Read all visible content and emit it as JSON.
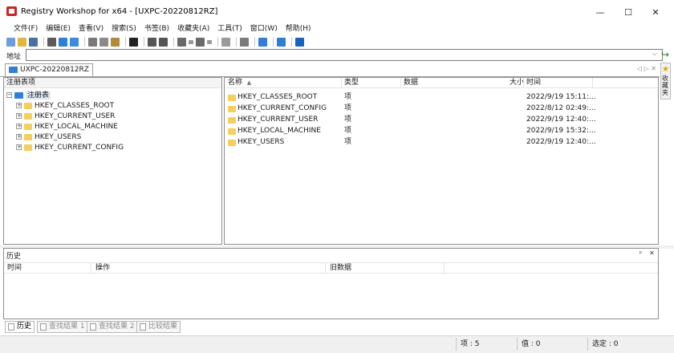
{
  "window": {
    "title": "Registry Workshop for x64 - [UXPC-20220812RZ]",
    "controls": {
      "minimize": "—",
      "maximize": "☐",
      "close": "✕"
    }
  },
  "menu": [
    "文件(F)",
    "编辑(E)",
    "查看(V)",
    "搜索(S)",
    "书签(B)",
    "收藏夹(A)",
    "工具(T)",
    "窗口(W)",
    "帮助(H)"
  ],
  "toolbar": {
    "icons": [
      "new-icon",
      "open-icon",
      "save-icon",
      "separator",
      "connect-icon",
      "computer-icon",
      "network-icon",
      "separator",
      "cut-icon",
      "copy-icon",
      "paste-icon",
      "separator",
      "delete-icon",
      "separator",
      "undo-icon",
      "redo-icon",
      "separator",
      "back-icon",
      "back-dropdown-icon",
      "forward-icon",
      "forward-dropdown-icon",
      "separator",
      "up-icon",
      "separator",
      "find-icon",
      "separator",
      "refresh-icon",
      "separator",
      "settings-icon",
      "separator",
      "help-icon"
    ],
    "colors": {
      "new-icon": "#6d9de0",
      "open-icon": "#e3b53e",
      "save-icon": "#4a6fa5",
      "connect-icon": "#5a5a5a",
      "computer-icon": "#2f7fd4",
      "network-icon": "#3d8bdc",
      "cut-icon": "#7a7a7a",
      "copy-icon": "#8a8a8a",
      "paste-icon": "#b38a3c",
      "delete-icon": "#222222",
      "undo-icon": "#555555",
      "redo-icon": "#555555",
      "back-icon": "#6a6a6a",
      "back-dropdown-icon": "#9a9a9a",
      "forward-icon": "#6a6a6a",
      "forward-dropdown-icon": "#9a9a9a",
      "up-icon": "#9a9a9a",
      "find-icon": "#7a7a7a",
      "refresh-icon": "#2f7fd4",
      "settings-icon": "#2f7fd4",
      "help-icon": "#1565c0"
    }
  },
  "address": {
    "label": "地址",
    "value": ""
  },
  "side_dock": {
    "favorites_label": "收藏夹"
  },
  "doc_tab": {
    "label": "UXPC-20220812RZ",
    "nav": "◁ ▷ ✕"
  },
  "tree": {
    "header": "注册表项",
    "root": "注册表",
    "hives": [
      "HKEY_CLASSES_ROOT",
      "HKEY_CURRENT_USER",
      "HKEY_LOCAL_MACHINE",
      "HKEY_USERS",
      "HKEY_CURRENT_CONFIG"
    ]
  },
  "values": {
    "columns": {
      "name": "名称",
      "sort_indicator": "▲",
      "type": "类型",
      "data": "数据",
      "size": "大小",
      "time": "时间"
    },
    "rows": [
      {
        "name": "HKEY_CLASSES_ROOT",
        "type": "项",
        "data": "",
        "size": "",
        "time": "2022/9/19 15:11:..."
      },
      {
        "name": "HKEY_CURRENT_CONFIG",
        "type": "项",
        "data": "",
        "size": "",
        "time": "2022/8/12 02:49:..."
      },
      {
        "name": "HKEY_CURRENT_USER",
        "type": "项",
        "data": "",
        "size": "",
        "time": "2022/9/19 12:40:..."
      },
      {
        "name": "HKEY_LOCAL_MACHINE",
        "type": "项",
        "data": "",
        "size": "",
        "time": "2022/9/19 15:32:..."
      },
      {
        "name": "HKEY_USERS",
        "type": "项",
        "data": "",
        "size": "",
        "time": "2022/9/19 12:40:..."
      }
    ]
  },
  "history": {
    "title": "历史",
    "pin": "ᵖ",
    "close": "✕",
    "columns": {
      "time": "时间",
      "operation": "操作",
      "old_data": "旧数据"
    }
  },
  "bottom_tabs": [
    "历史",
    "查找结果 1",
    "查找结果 2",
    "比较结果"
  ],
  "status": {
    "count": "项 : 5",
    "value_count": "值 : 0",
    "selected": "选定 : 0"
  }
}
